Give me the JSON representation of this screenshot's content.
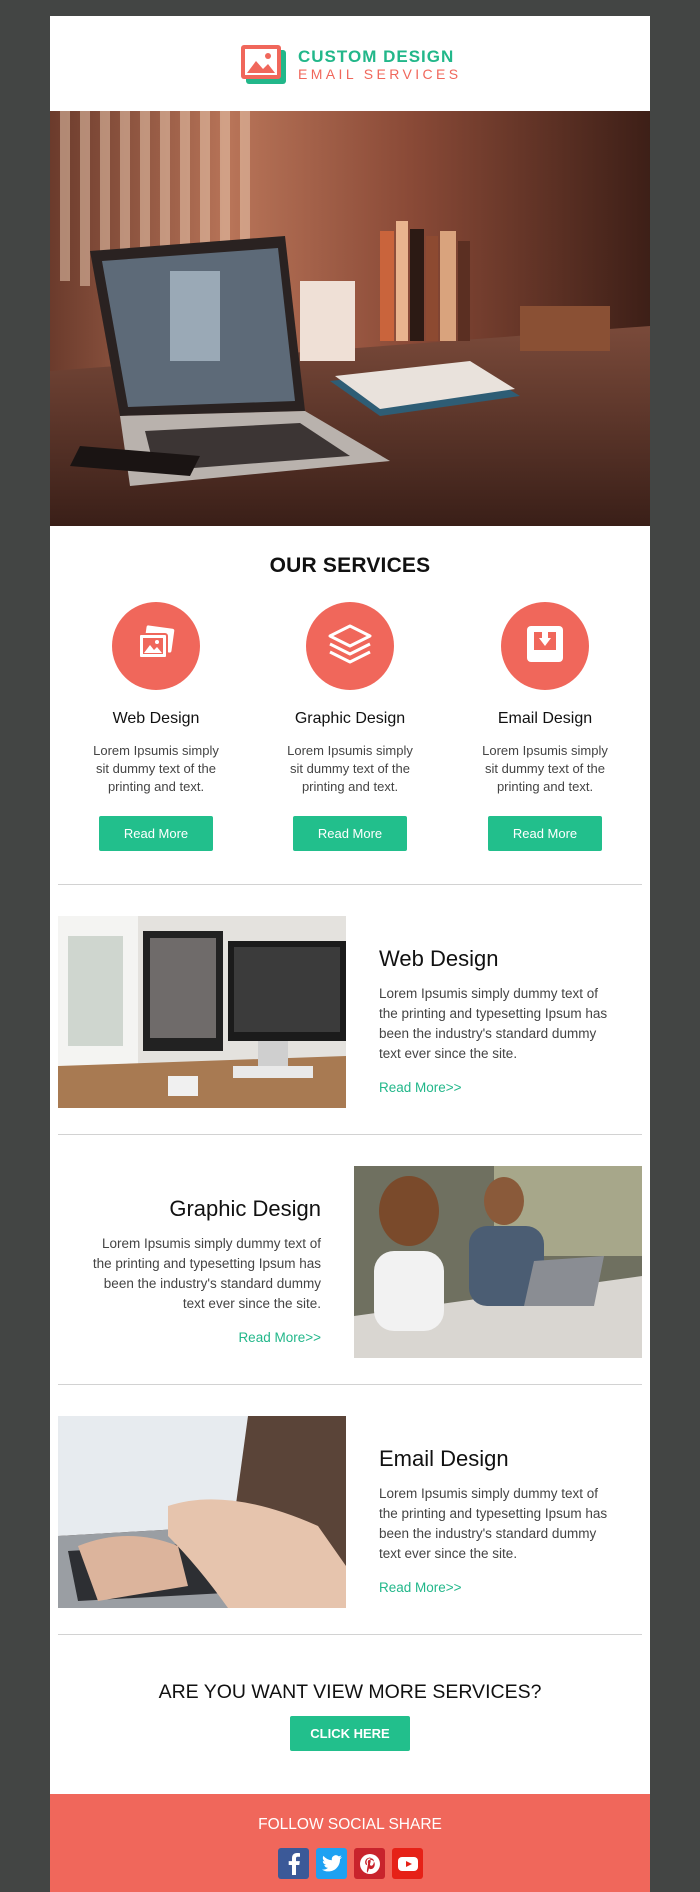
{
  "header": {
    "logo_line1": "CUSTOM DESIGN",
    "logo_line2": "EMAIL SERVICES"
  },
  "services": {
    "heading": "OUR SERVICES",
    "items": [
      {
        "title": "Web Design",
        "text": "Lorem Ipsumis simply sit dummy text of the printing and text.",
        "button": "Read More",
        "icon": "photos-icon"
      },
      {
        "title": "Graphic Design",
        "text": "Lorem Ipsumis simply sit dummy text of the printing and text.",
        "button": "Read More",
        "icon": "layers-icon"
      },
      {
        "title": "Email Design",
        "text": "Lorem Ipsumis simply sit dummy text of the printing and text.",
        "button": "Read More",
        "icon": "inbox-icon"
      }
    ]
  },
  "features": [
    {
      "title": "Web Design",
      "text": "Lorem Ipsumis simply dummy text of the printing and typesetting Ipsum has been the industry's standard dummy text ever since the site.",
      "link": "Read More>>"
    },
    {
      "title": "Graphic Design",
      "text": "Lorem Ipsumis simply dummy text of the printing and typesetting Ipsum has been the industry's standard dummy text ever since the site.",
      "link": "Read More>>"
    },
    {
      "title": "Email Design",
      "text": "Lorem Ipsumis simply dummy text of the printing and typesetting Ipsum has been the industry's standard dummy text ever since the site.",
      "link": "Read More>>"
    }
  ],
  "cta": {
    "question": "ARE YOU WANT VIEW MORE SERVICES?",
    "button": "CLICK HERE"
  },
  "footer": {
    "follow": "FOLLOW SOCIAL SHARE",
    "socials": [
      {
        "name": "facebook-icon",
        "color": "#3b5998"
      },
      {
        "name": "twitter-icon",
        "color": "#1da1f2"
      },
      {
        "name": "pinterest-icon",
        "color": "#c8232c"
      },
      {
        "name": "youtube-icon",
        "color": "#e62117"
      }
    ]
  },
  "colors": {
    "accent": "#f0675b",
    "green": "#22bf8c",
    "background": "#434544"
  }
}
